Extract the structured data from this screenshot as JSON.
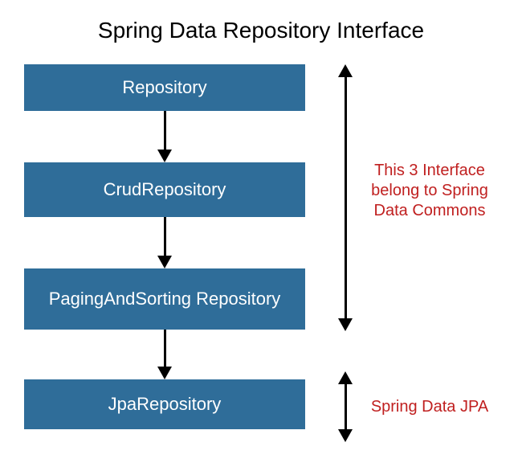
{
  "title": "Spring Data Repository Interface",
  "boxes": {
    "b1": "Repository",
    "b2": "CrudRepository",
    "b3": "PagingAndSorting Repository",
    "b4": "JpaRepository"
  },
  "annotations": {
    "commons": "This 3 Interface belong to Spring Data Commons",
    "jpa": "Spring Data JPA"
  },
  "colors": {
    "box_bg": "#2f6d99",
    "box_text": "#ffffff",
    "annotation_text": "#c02020",
    "arrow": "#000000"
  }
}
